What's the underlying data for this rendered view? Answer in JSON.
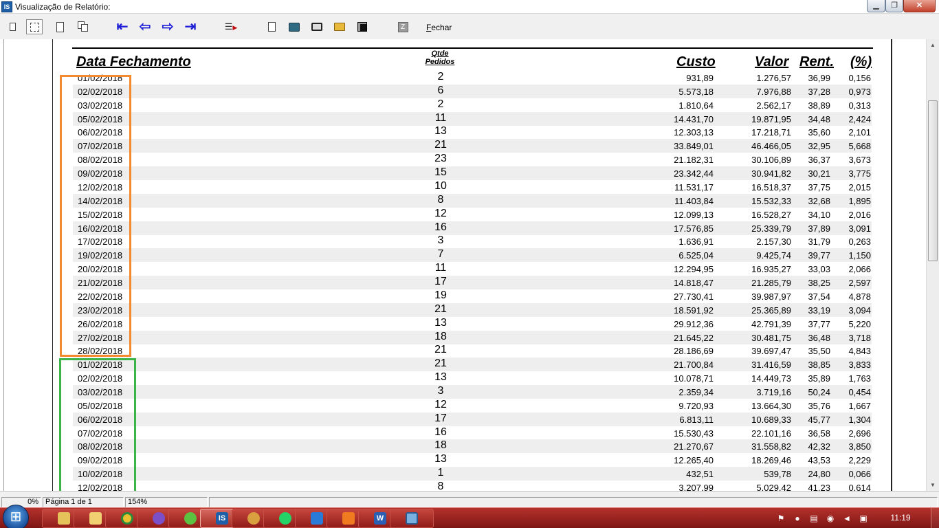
{
  "window": {
    "title": "Visualização de Relatório:",
    "app_icon_text": "IS"
  },
  "toolbar": {
    "close_label": "Fechar"
  },
  "report": {
    "headers": {
      "date": "Data Fechamento",
      "qty_line1": "Qtde",
      "qty_line2": "Pedidos",
      "custo": "Custo",
      "valor": "Valor",
      "rent": "Rent.",
      "pct": "(%)"
    },
    "rows": [
      {
        "date": "01/02/2018",
        "qty": "2",
        "custo": "931,89",
        "valor": "1.276,57",
        "rent": "36,99",
        "pct": "0,156"
      },
      {
        "date": "02/02/2018",
        "qty": "6",
        "custo": "5.573,18",
        "valor": "7.976,88",
        "rent": "37,28",
        "pct": "0,973"
      },
      {
        "date": "03/02/2018",
        "qty": "2",
        "custo": "1.810,64",
        "valor": "2.562,17",
        "rent": "38,89",
        "pct": "0,313"
      },
      {
        "date": "05/02/2018",
        "qty": "11",
        "custo": "14.431,70",
        "valor": "19.871,95",
        "rent": "34,48",
        "pct": "2,424"
      },
      {
        "date": "06/02/2018",
        "qty": "13",
        "custo": "12.303,13",
        "valor": "17.218,71",
        "rent": "35,60",
        "pct": "2,101"
      },
      {
        "date": "07/02/2018",
        "qty": "21",
        "custo": "33.849,01",
        "valor": "46.466,05",
        "rent": "32,95",
        "pct": "5,668"
      },
      {
        "date": "08/02/2018",
        "qty": "23",
        "custo": "21.182,31",
        "valor": "30.106,89",
        "rent": "36,37",
        "pct": "3,673"
      },
      {
        "date": "09/02/2018",
        "qty": "15",
        "custo": "23.342,44",
        "valor": "30.941,82",
        "rent": "30,21",
        "pct": "3,775"
      },
      {
        "date": "12/02/2018",
        "qty": "10",
        "custo": "11.531,17",
        "valor": "16.518,37",
        "rent": "37,75",
        "pct": "2,015"
      },
      {
        "date": "14/02/2018",
        "qty": "8",
        "custo": "11.403,84",
        "valor": "15.532,33",
        "rent": "32,68",
        "pct": "1,895"
      },
      {
        "date": "15/02/2018",
        "qty": "12",
        "custo": "12.099,13",
        "valor": "16.528,27",
        "rent": "34,10",
        "pct": "2,016"
      },
      {
        "date": "16/02/2018",
        "qty": "16",
        "custo": "17.576,85",
        "valor": "25.339,79",
        "rent": "37,89",
        "pct": "3,091"
      },
      {
        "date": "17/02/2018",
        "qty": "3",
        "custo": "1.636,91",
        "valor": "2.157,30",
        "rent": "31,79",
        "pct": "0,263"
      },
      {
        "date": "19/02/2018",
        "qty": "7",
        "custo": "6.525,04",
        "valor": "9.425,74",
        "rent": "39,77",
        "pct": "1,150"
      },
      {
        "date": "20/02/2018",
        "qty": "11",
        "custo": "12.294,95",
        "valor": "16.935,27",
        "rent": "33,03",
        "pct": "2,066"
      },
      {
        "date": "21/02/2018",
        "qty": "17",
        "custo": "14.818,47",
        "valor": "21.285,79",
        "rent": "38,25",
        "pct": "2,597"
      },
      {
        "date": "22/02/2018",
        "qty": "19",
        "custo": "27.730,41",
        "valor": "39.987,97",
        "rent": "37,54",
        "pct": "4,878"
      },
      {
        "date": "23/02/2018",
        "qty": "21",
        "custo": "18.591,92",
        "valor": "25.365,89",
        "rent": "33,19",
        "pct": "3,094"
      },
      {
        "date": "26/02/2018",
        "qty": "13",
        "custo": "29.912,36",
        "valor": "42.791,39",
        "rent": "37,77",
        "pct": "5,220"
      },
      {
        "date": "27/02/2018",
        "qty": "18",
        "custo": "21.645,22",
        "valor": "30.481,75",
        "rent": "36,48",
        "pct": "3,718"
      },
      {
        "date": "28/02/2018",
        "qty": "21",
        "custo": "28.186,69",
        "valor": "39.697,47",
        "rent": "35,50",
        "pct": "4,843"
      },
      {
        "date": "01/02/2018",
        "qty": "21",
        "custo": "21.700,84",
        "valor": "31.416,59",
        "rent": "38,85",
        "pct": "3,833"
      },
      {
        "date": "02/02/2018",
        "qty": "13",
        "custo": "10.078,71",
        "valor": "14.449,73",
        "rent": "35,89",
        "pct": "1,763"
      },
      {
        "date": "03/02/2018",
        "qty": "3",
        "custo": "2.359,34",
        "valor": "3.719,16",
        "rent": "50,24",
        "pct": "0,454"
      },
      {
        "date": "05/02/2018",
        "qty": "12",
        "custo": "9.720,93",
        "valor": "13.664,30",
        "rent": "35,76",
        "pct": "1,667"
      },
      {
        "date": "06/02/2018",
        "qty": "17",
        "custo": "6.813,11",
        "valor": "10.689,33",
        "rent": "45,77",
        "pct": "1,304"
      },
      {
        "date": "07/02/2018",
        "qty": "16",
        "custo": "15.530,43",
        "valor": "22.101,16",
        "rent": "36,58",
        "pct": "2,696"
      },
      {
        "date": "08/02/2018",
        "qty": "18",
        "custo": "21.270,67",
        "valor": "31.558,82",
        "rent": "42,32",
        "pct": "3,850"
      },
      {
        "date": "09/02/2018",
        "qty": "13",
        "custo": "12.265,40",
        "valor": "18.269,46",
        "rent": "43,53",
        "pct": "2,229"
      },
      {
        "date": "10/02/2018",
        "qty": "1",
        "custo": "432,51",
        "valor": "539,78",
        "rent": "24,80",
        "pct": "0,066"
      },
      {
        "date": "12/02/2018",
        "qty": "8",
        "custo": "3.207,99",
        "valor": "5.029,42",
        "rent": "41,23",
        "pct": "0,614"
      }
    ]
  },
  "status": {
    "progress": "0%",
    "page": "Página 1 de 1",
    "zoom": "154%"
  },
  "taskbar": {
    "clock": "11:19",
    "active_app_text": "IS"
  },
  "colors": {
    "highlight_box_1": "#f28a30",
    "highlight_box_2": "#3cb44a",
    "taskbar": "#9a2420"
  }
}
